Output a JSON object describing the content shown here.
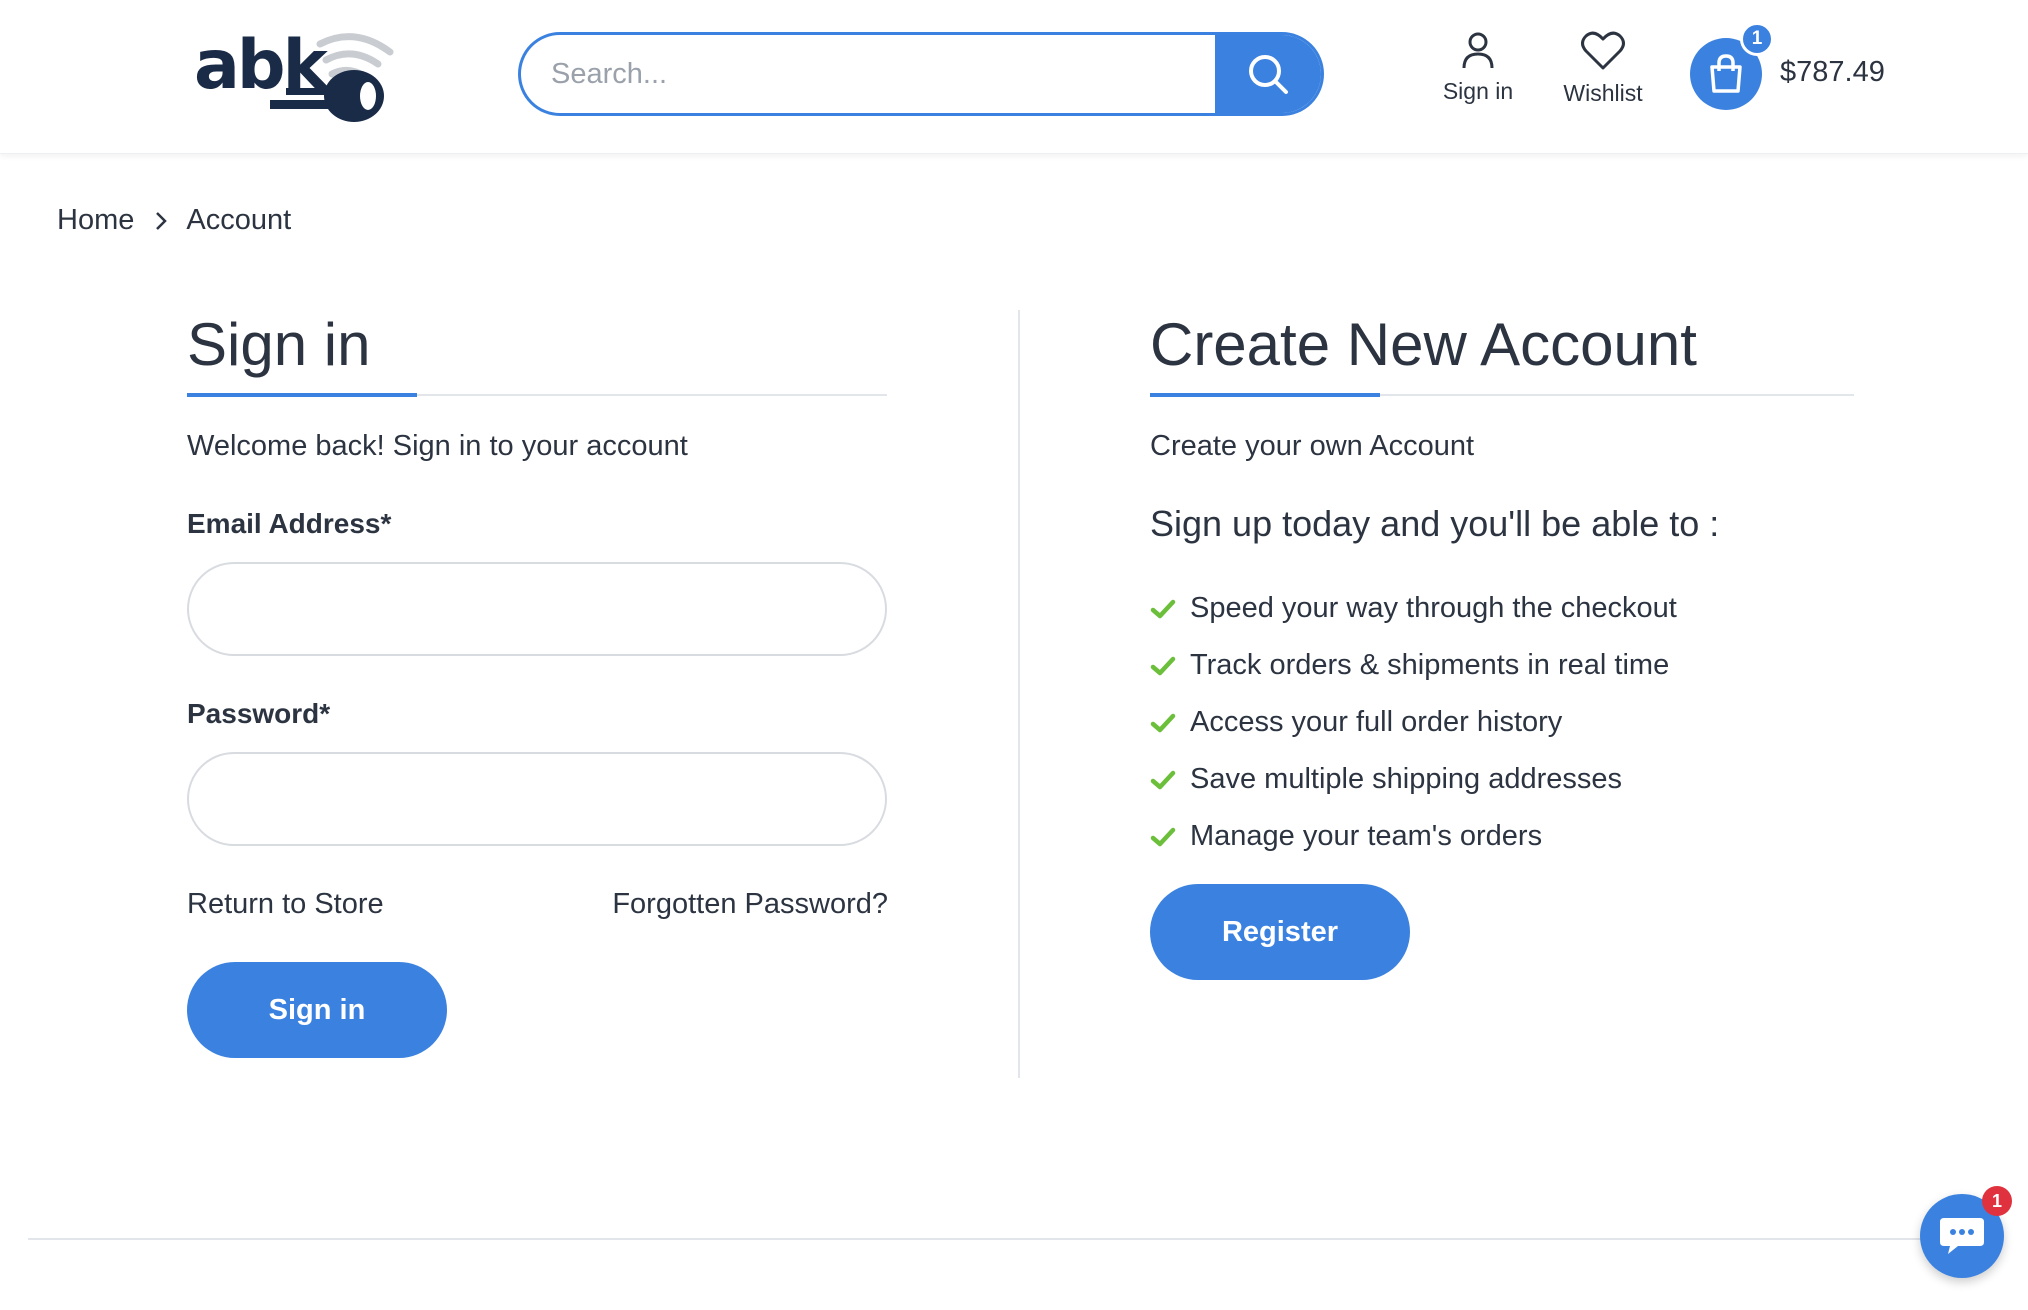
{
  "header": {
    "logo_text": "abk",
    "search": {
      "placeholder": "Search...",
      "button_icon": "search-icon"
    },
    "signin_label": "Sign in",
    "wishlist_label": "Wishlist",
    "cart": {
      "count": "1",
      "total": "$787.49",
      "icon": "shopping-bag-icon"
    }
  },
  "breadcrumb": {
    "items": [
      "Home",
      "Account"
    ]
  },
  "signin": {
    "title": "Sign in",
    "welcome": "Welcome back! Sign in to your account",
    "email_label": "Email Address*",
    "email_value": "",
    "password_label": "Password*",
    "password_value": "",
    "return_link": "Return to Store",
    "forgot_link": "Forgotten Password?",
    "button": "Sign in"
  },
  "create": {
    "title": "Create New Account",
    "subtitle": "Create your own Account",
    "heading": "Sign up today and you'll be able to :",
    "benefits": [
      "Speed your way through the checkout",
      "Track orders & shipments in real time",
      "Access your full order history",
      "Save multiple shipping addresses",
      "Manage your team's orders"
    ],
    "button": "Register"
  },
  "chat": {
    "badge": "1",
    "icon": "chat-icon"
  },
  "colors": {
    "accent": "#3b82e0",
    "text": "#2c3441",
    "check": "#6cbf3a",
    "badge_red": "#e0323e"
  }
}
